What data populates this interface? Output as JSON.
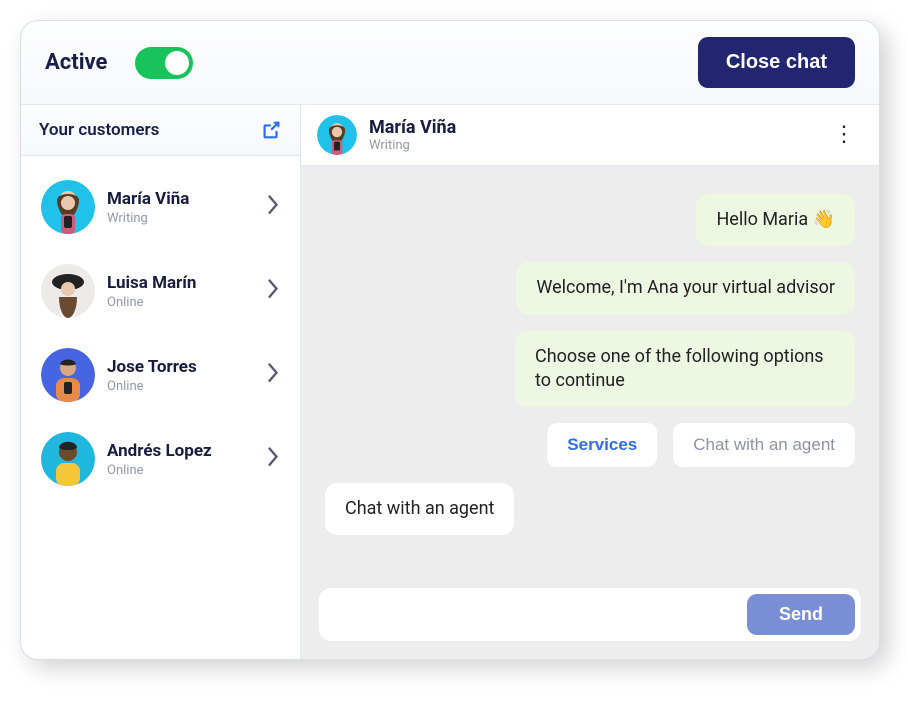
{
  "header": {
    "active_label": "Active",
    "close_label": "Close chat",
    "toggle_on": true
  },
  "sidebar": {
    "title": "Your customers",
    "items": [
      {
        "name": "María Viña",
        "status": "Writing",
        "avatar_bg": "#21c2ea"
      },
      {
        "name": "Luisa Marín",
        "status": "Online",
        "avatar_bg": "#ecebe9"
      },
      {
        "name": "Jose Torres",
        "status": "Online",
        "avatar_bg": "#4665e2"
      },
      {
        "name": "Andrés Lopez",
        "status": "Online",
        "avatar_bg": "#1fb7de"
      }
    ]
  },
  "chat": {
    "header": {
      "name": "María Viña",
      "status": "Writing"
    },
    "messages": [
      {
        "type": "bot",
        "text": "Hello Maria 👋"
      },
      {
        "type": "bot",
        "text": "Welcome, I'm Ana your virtual advisor"
      },
      {
        "type": "bot",
        "text": "Choose one of the following options to continue"
      }
    ],
    "options": [
      {
        "label": "Services",
        "style": "primary"
      },
      {
        "label": "Chat with an agent",
        "style": "secondary"
      }
    ],
    "user_message": "Chat with an agent",
    "composer": {
      "placeholder": "",
      "send_label": "Send"
    }
  }
}
